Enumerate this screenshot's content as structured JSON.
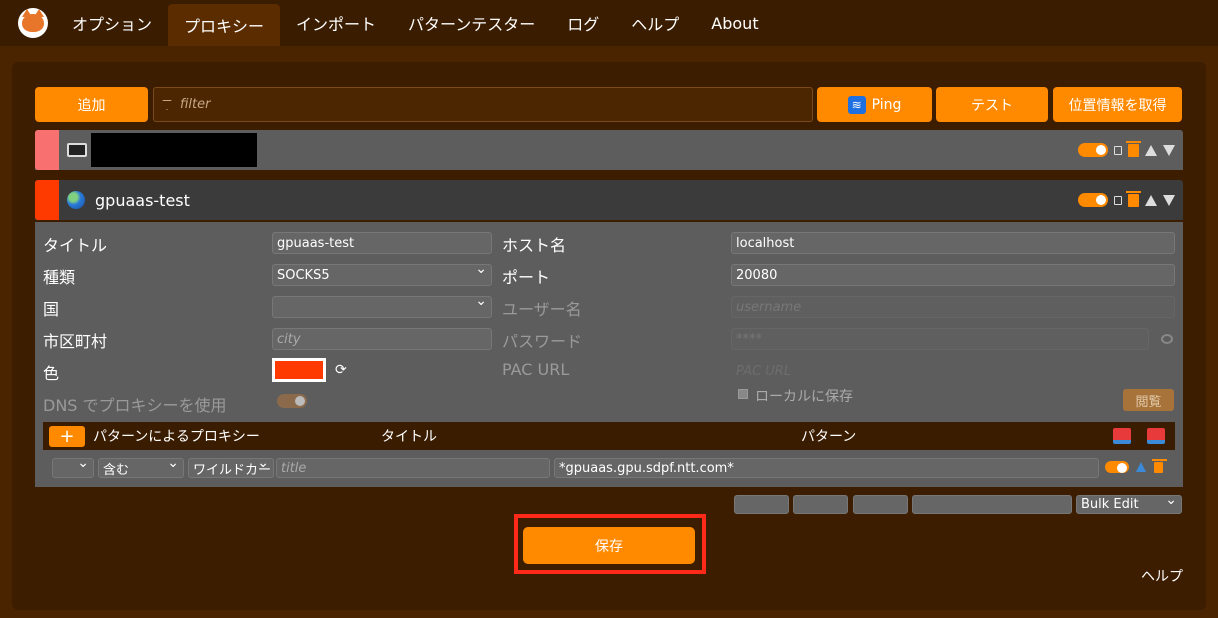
{
  "nav": {
    "tabs": [
      {
        "label": "オプション"
      },
      {
        "label": "プロキシー"
      },
      {
        "label": "インポート"
      },
      {
        "label": "パターンテスター"
      },
      {
        "label": "ログ"
      },
      {
        "label": "ヘルプ"
      },
      {
        "label": "About"
      }
    ],
    "active_tab": "プロキシー"
  },
  "toolbar": {
    "add_label": "追加",
    "filter_placeholder": "filter",
    "ping_label": "Ping",
    "test_label": "テスト",
    "geo_label": "位置情報を取得"
  },
  "proxies": [
    {
      "title": "",
      "color": "#f87070",
      "icon": "monitor-icon"
    },
    {
      "title": "gpuaas-test",
      "color": "#ff3a00",
      "icon": "globe-icon"
    }
  ],
  "detail": {
    "title_label": "タイトル",
    "title_value": "gpuaas-test",
    "type_label": "種類",
    "type_value": "SOCKS5",
    "country_label": "国",
    "country_value": "",
    "city_label": "市区町村",
    "city_placeholder": "city",
    "color_label": "色",
    "color_value": "#ff3a00",
    "dns_label": "DNS でプロキシーを使用",
    "host_label": "ホスト名",
    "host_value": "localhost",
    "port_label": "ポート",
    "port_value": "20080",
    "user_label": "ユーザー名",
    "user_placeholder": "username",
    "pass_label": "パスワード",
    "pass_placeholder": "****",
    "pac_label": "PAC URL",
    "pac_placeholder": "PAC URL",
    "local_save_label": "ローカルに保存",
    "browse_label": "閲覧"
  },
  "patterns": {
    "header_label": "パターンによるプロキシー",
    "col_title": "タイトル",
    "col_pattern": "パターン",
    "rows": [
      {
        "include": "含む",
        "type": "ワイルドカー",
        "title_placeholder": "title",
        "pattern": "*gpuaas.gpu.sdpf.ntt.com*"
      }
    ]
  },
  "bulk_edit_label": "Bulk Edit",
  "save_label": "保存",
  "help_link": "ヘルプ"
}
